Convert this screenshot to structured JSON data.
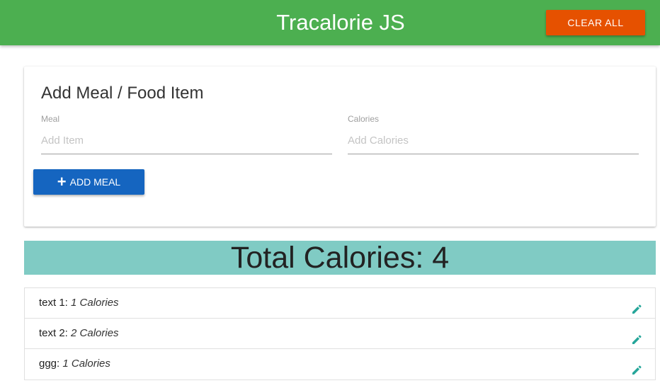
{
  "header": {
    "brand": "Tracalorie JS",
    "clear_label": "CLEAR ALL"
  },
  "form": {
    "title": "Add Meal / Food Item",
    "meal_label": "Meal",
    "meal_placeholder": "Add Item",
    "meal_value": "",
    "calories_label": "Calories",
    "calories_placeholder": "Add Calories",
    "calories_value": "",
    "add_label": "ADD MEAL",
    "add_icon": "plus-icon"
  },
  "total": {
    "label": "Total Calories: 4"
  },
  "items": [
    {
      "name": "text 1:",
      "calories": "1 Calories",
      "icon": "pencil-icon"
    },
    {
      "name": "text 2:",
      "calories": "2 Calories",
      "icon": "pencil-icon"
    },
    {
      "name": "ggg:",
      "calories": "1 Calories",
      "icon": "pencil-icon"
    }
  ],
  "colors": {
    "navbar": "#4caf50",
    "clear_button": "#e65100",
    "add_button": "#1565c0",
    "total_bar": "#80cbc4",
    "edit_icon": "#26a69a"
  }
}
